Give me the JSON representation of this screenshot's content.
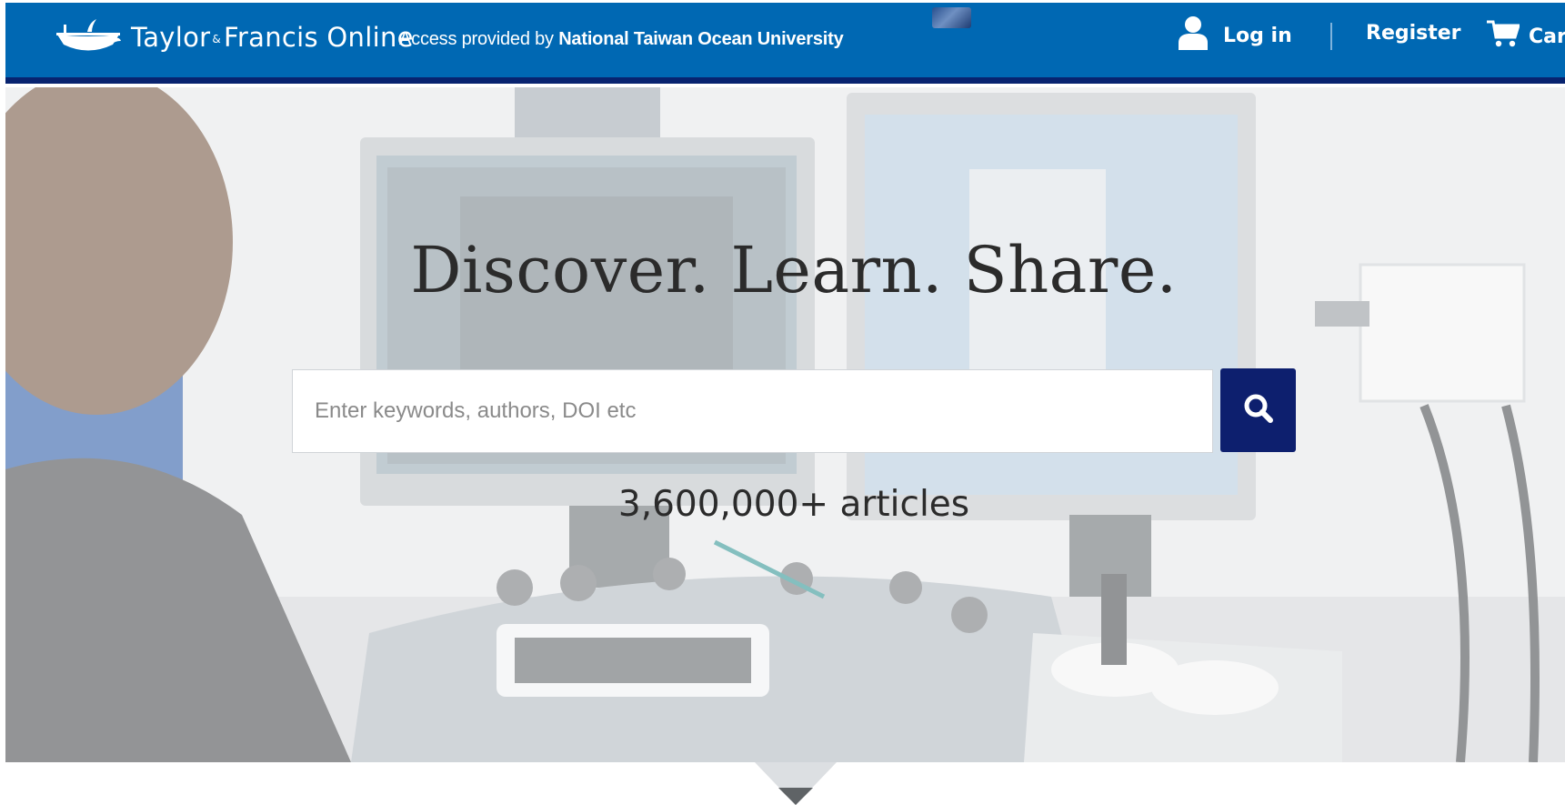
{
  "header": {
    "logo": {
      "brand_first": "Taylor",
      "brand_amp": "&",
      "brand_second": "Francis Online",
      "icon": "lamp-logo-icon"
    },
    "access": {
      "prefix": "Access provided by",
      "institution": "National Taiwan Ocean University"
    },
    "nav": {
      "login_label": "Log in",
      "login_icon": "user-icon",
      "register_label": "Register",
      "cart_label": "Cart",
      "cart_icon": "cart-icon"
    },
    "colors": {
      "bar": "#0068b3",
      "bar_border": "#08236f"
    }
  },
  "hero": {
    "title": "Discover. Learn. Share.",
    "search": {
      "placeholder": "Enter keywords, authors, DOI etc",
      "value": "",
      "button_icon": "search-icon",
      "button_color": "#0d1f6e"
    },
    "stat": "3,600,000+ articles",
    "background": "laboratory-monitors-photo",
    "scroll_icon": "chevron-down-icon"
  }
}
